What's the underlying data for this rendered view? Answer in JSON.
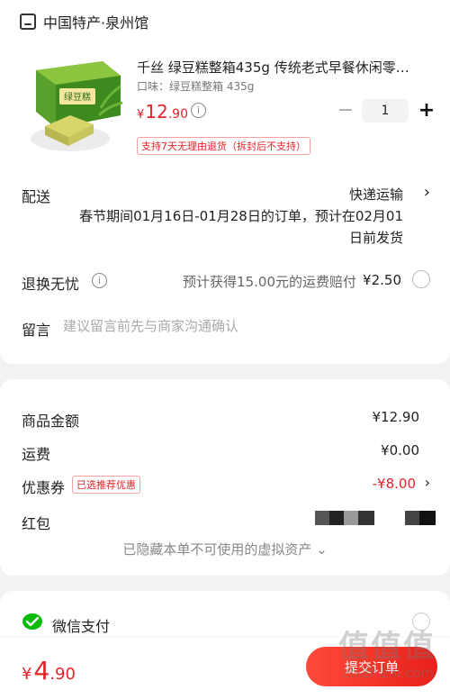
{
  "shop": {
    "name": "中国特产·泉州馆",
    "icon": "shop-icon"
  },
  "product": {
    "title": "千丝 绿豆糕整箱435g 传统老式早餐休闲零…",
    "spec": "口味：绿豆糕整箱 435g",
    "price_yen": "¥",
    "price_int": "12",
    "price_dec": ".90",
    "quantity": "1",
    "minus": "−",
    "plus": "+",
    "return_policy": "支持7天无理由退货（拆封后不支持）",
    "box_text": "绿豆糕"
  },
  "delivery": {
    "label": "配送",
    "method": "快递运输",
    "note": "春节期间01月16日-01月28日的订单，预计在02月01日前发货"
  },
  "worry_free": {
    "label": "退换无忧",
    "desc": "预计获得15.00元的运费赔付",
    "price": "¥2.50"
  },
  "memo": {
    "label": "留言",
    "placeholder": "建议留言前先与商家沟通确认"
  },
  "pricing": {
    "goods_label": "商品金额",
    "goods_value": "¥12.90",
    "shipping_label": "运费",
    "shipping_value": "¥0.00",
    "coupon_label": "优惠券",
    "coupon_tag": "已选推荐优惠",
    "coupon_value": "-¥8.00",
    "hongbao_label": "红包",
    "hidden_assets": "已隐藏本单不可使用的虚拟资产 ⌄"
  },
  "payment": {
    "method": "微信支付",
    "icon": "wechat-pay-icon"
  },
  "footer": {
    "total_yen": "¥",
    "total_int": "4",
    "total_dec": ".90",
    "submit_label": "提交订单"
  },
  "watermark": {
    "text": "值值值",
    "url": "zhizhizhi.com"
  },
  "colors": {
    "accent": "#e3242b",
    "wechat": "#09bb07"
  }
}
